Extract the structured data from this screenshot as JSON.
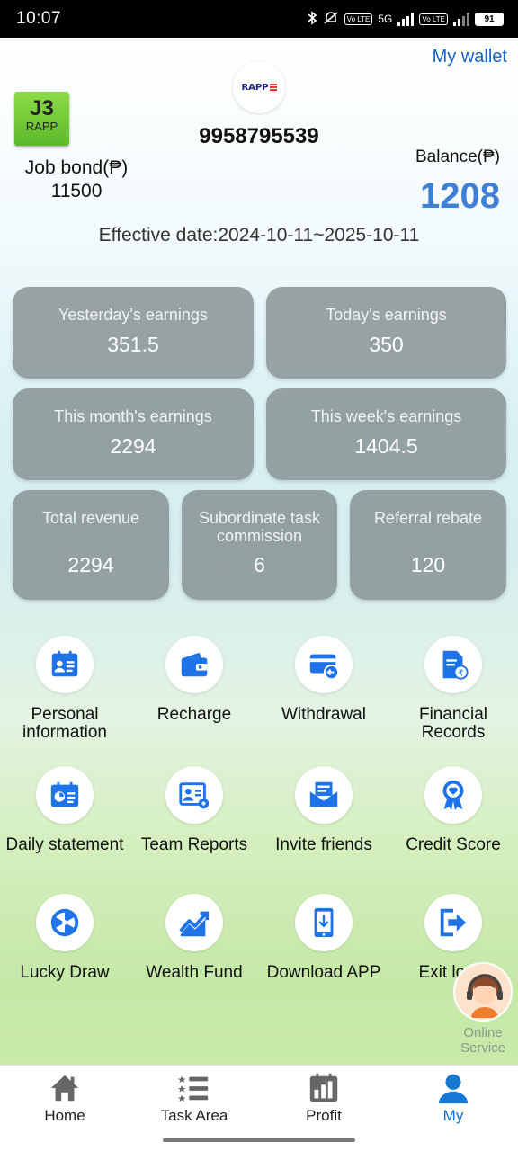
{
  "status_bar": {
    "time": "10:07",
    "network": "5G",
    "volte": "Vo LTE",
    "battery": "91"
  },
  "header": {
    "wallet_link": "My wallet",
    "logo_text": "RAPP",
    "phone": "9958795539",
    "level_badge": {
      "level": "J3",
      "name": "RAPP"
    },
    "job_bond_label": "Job bond(₱)",
    "job_bond_value": "11500",
    "balance_label": "Balance(₱)",
    "balance_value": "1208",
    "effective_date": "Effective date:2024-10-11~2025-10-11"
  },
  "earnings": {
    "yesterday": {
      "label": "Yesterday's earnings",
      "value": "351.5"
    },
    "today": {
      "label": "Today's earnings",
      "value": "350"
    },
    "month": {
      "label": "This month's earnings",
      "value": "2294"
    },
    "week": {
      "label": "This week's earnings",
      "value": "1404.5"
    },
    "total": {
      "label": "Total revenue",
      "value": "2294"
    },
    "subordinate": {
      "label": "Subordinate task commission",
      "value": "6"
    },
    "referral": {
      "label": "Referral rebate",
      "value": "120"
    }
  },
  "menu": [
    {
      "label": "Personal information",
      "icon": "id-card-icon"
    },
    {
      "label": "Recharge",
      "icon": "wallet-icon"
    },
    {
      "label": "Withdrawal",
      "icon": "card-withdraw-icon"
    },
    {
      "label": "Financial Records",
      "icon": "document-rupee-icon"
    },
    {
      "label": "Daily statement",
      "icon": "daily-statement-icon"
    },
    {
      "label": "Team Reports",
      "icon": "team-reports-icon"
    },
    {
      "label": "Invite friends",
      "icon": "envelope-icon"
    },
    {
      "label": "Credit Score",
      "icon": "award-ribbon-icon"
    },
    {
      "label": "Lucky Draw",
      "icon": "wheel-icon"
    },
    {
      "label": "Wealth Fund",
      "icon": "trend-chart-icon"
    },
    {
      "label": "Download APP",
      "icon": "phone-download-icon"
    },
    {
      "label": "Exit login",
      "icon": "exit-icon"
    }
  ],
  "online_service": {
    "label": "Online Service"
  },
  "tabs": [
    {
      "label": "Home",
      "icon": "home-icon"
    },
    {
      "label": "Task Area",
      "icon": "list-icon"
    },
    {
      "label": "Profit",
      "icon": "bar-chart-icon"
    },
    {
      "label": "My",
      "icon": "person-icon",
      "active": true
    }
  ],
  "colors": {
    "accent": "#1976d2",
    "balance": "#3f7fd6",
    "icon_blue": "#1e73e8",
    "card_bg": "#808a8c",
    "badge_green": "#6cc836"
  }
}
